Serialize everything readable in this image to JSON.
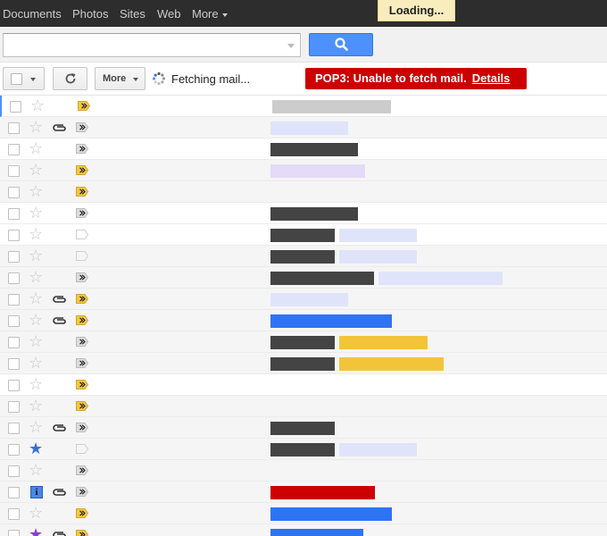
{
  "topnav": {
    "items": [
      "Documents",
      "Photos",
      "Sites",
      "Web"
    ],
    "more_label": "More",
    "loading_label": "Loading..."
  },
  "search": {
    "value": "",
    "placeholder": ""
  },
  "toolbar": {
    "more_label": "More",
    "status_text": "Fetching mail...",
    "error_text": "POP3: Unable to fetch mail.",
    "error_link": "Details"
  },
  "colors": {
    "accent_blue": "#4d90fe",
    "error_red": "#cc0000",
    "label_dark": "#444444",
    "label_lightgray": "#cccccc",
    "label_paleblue": "#e0e4fa",
    "label_lavender": "#e3dbf7",
    "label_blue": "#2f73f5",
    "label_gold": "#f2c43a",
    "label_red": "#cc0000",
    "importance_yellow": "#f4c842",
    "importance_gray": "#dddddd"
  },
  "rows": [
    {
      "unread": true,
      "star": "none",
      "clip": false,
      "imp": "yellow",
      "bars": [
        "lightgray"
      ]
    },
    {
      "unread": false,
      "star": "none",
      "clip": true,
      "imp": "gray",
      "bars": [
        "paleblue"
      ]
    },
    {
      "unread": true,
      "star": "none",
      "clip": false,
      "imp": "gray",
      "bars": [
        "dark"
      ]
    },
    {
      "unread": false,
      "star": "none",
      "clip": false,
      "imp": "yellow",
      "bars": [
        "lavender"
      ]
    },
    {
      "unread": false,
      "star": "none",
      "clip": false,
      "imp": "yellow",
      "bars": []
    },
    {
      "unread": true,
      "star": "none",
      "clip": false,
      "imp": "gray",
      "bars": [
        "dark"
      ]
    },
    {
      "unread": true,
      "star": "none",
      "clip": false,
      "imp": "outline",
      "bars": [
        "dark-s",
        "paleblue"
      ]
    },
    {
      "unread": false,
      "star": "none",
      "clip": false,
      "imp": "outline",
      "bars": [
        "dark-s",
        "paleblue"
      ]
    },
    {
      "unread": false,
      "star": "none",
      "clip": false,
      "imp": "gray",
      "bars": [
        "dark-m",
        "paleblue-l"
      ]
    },
    {
      "unread": false,
      "star": "none",
      "clip": true,
      "imp": "yellow",
      "bars": [
        "paleblue"
      ]
    },
    {
      "unread": false,
      "star": "none",
      "clip": true,
      "imp": "yellow",
      "bars": [
        "blue"
      ]
    },
    {
      "unread": false,
      "star": "none",
      "clip": false,
      "imp": "gray",
      "bars": [
        "dark-s",
        "gold"
      ]
    },
    {
      "unread": false,
      "star": "none",
      "clip": false,
      "imp": "gray",
      "bars": [
        "dark-s",
        "gold-l"
      ]
    },
    {
      "unread": true,
      "star": "none",
      "clip": false,
      "imp": "yellow",
      "bars": []
    },
    {
      "unread": false,
      "star": "none",
      "clip": false,
      "imp": "yellow",
      "bars": []
    },
    {
      "unread": false,
      "star": "none",
      "clip": true,
      "imp": "gray",
      "bars": [
        "dark-s"
      ]
    },
    {
      "unread": false,
      "star": "blue",
      "clip": false,
      "imp": "outline",
      "bars": [
        "dark-s",
        "paleblue"
      ]
    },
    {
      "unread": false,
      "star": "none",
      "clip": false,
      "imp": "gray",
      "bars": []
    },
    {
      "unread": false,
      "star": "info",
      "clip": true,
      "imp": "gray",
      "bars": [
        "red"
      ]
    },
    {
      "unread": false,
      "star": "none",
      "clip": false,
      "imp": "yellow",
      "bars": [
        "blue"
      ]
    },
    {
      "unread": false,
      "star": "purple",
      "clip": true,
      "imp": "yellow",
      "bars": [
        "blue-s"
      ]
    }
  ]
}
